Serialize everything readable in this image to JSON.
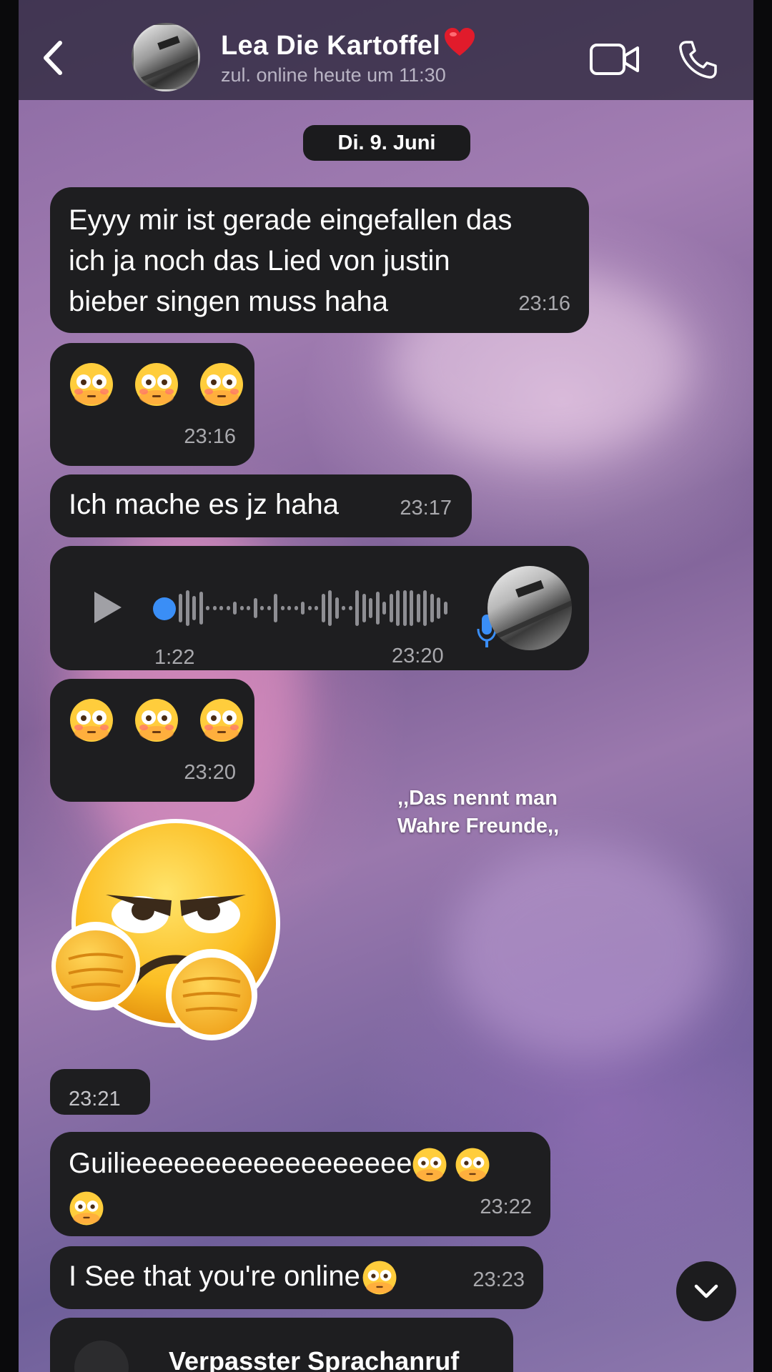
{
  "header": {
    "contact_name": "Lea Die Kartoffel",
    "name_emoji": "heart-emoji",
    "status": "zul. online heute um 11:30",
    "icons": [
      "back-chevron-icon",
      "video-call-icon",
      "phone-icon"
    ]
  },
  "date_separator": "Di. 9. Juni",
  "messages": [
    {
      "text": "Eyyy mir ist gerade eingefallen das ich ja noch das Lied von justin bieber singen muss haha",
      "lines": [
        "Eyyy mir ist gerade eingefallen das",
        "ich ja noch das Lied von justin",
        "bieber singen muss haha"
      ],
      "time": "23:16"
    },
    {
      "emoji": "flushed-face x3",
      "time": "23:16"
    },
    {
      "text": "Ich mache es jz haha",
      "time": "23:17"
    },
    {
      "voice_duration": "1:22",
      "time": "23:20"
    },
    {
      "emoji": "flushed-face x3",
      "time": "23:20"
    },
    {
      "sticker": "angry-face-fists-sticker",
      "time": "23:21"
    },
    {
      "text": "Guilieeeeeeeeeeeeeeeeee",
      "time": "23:22"
    },
    {
      "text": "I See that you're online",
      "time": "23:23"
    },
    {
      "text": "Verpasster Sprachanruf"
    }
  ],
  "overlay_caption": {
    "line1": ",,Das nennt man",
    "line2": "Wahre Freunde,,"
  },
  "colors": {
    "bubble": "#1e1e20",
    "accent": "#3a8ef6",
    "time": "#a9a9ad"
  }
}
